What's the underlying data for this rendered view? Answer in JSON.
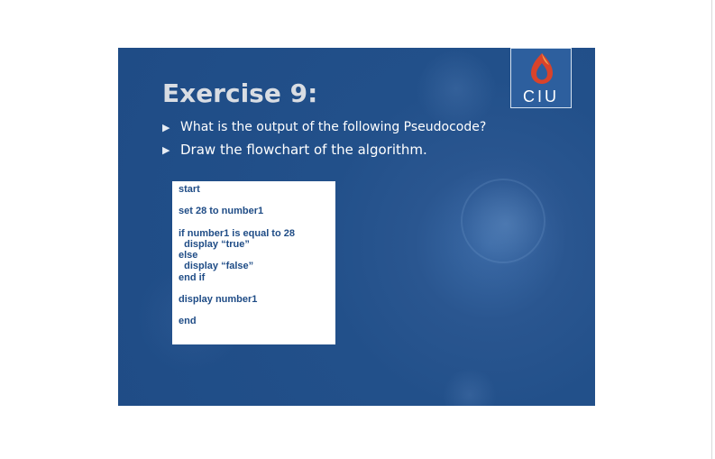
{
  "slide": {
    "title": "Exercise 9:",
    "logo": {
      "text": "CIU",
      "colors": {
        "red": "#d8432b",
        "background": "#2d5f9e"
      }
    },
    "bullets": [
      {
        "text": "What is the output of the following Pseudocode?"
      },
      {
        "text": "Draw the flowchart of the algorithm."
      }
    ],
    "code_lines": [
      "start",
      "",
      "set 28 to number1",
      "",
      "if number1 is equal to 28",
      "  display “true”",
      "else",
      "  display “false”",
      "end if",
      "",
      "display number1",
      "",
      "end"
    ],
    "colors": {
      "background": "#1f4c86",
      "code_text": "#1f4c86",
      "title_text": "#d9dde3"
    }
  }
}
